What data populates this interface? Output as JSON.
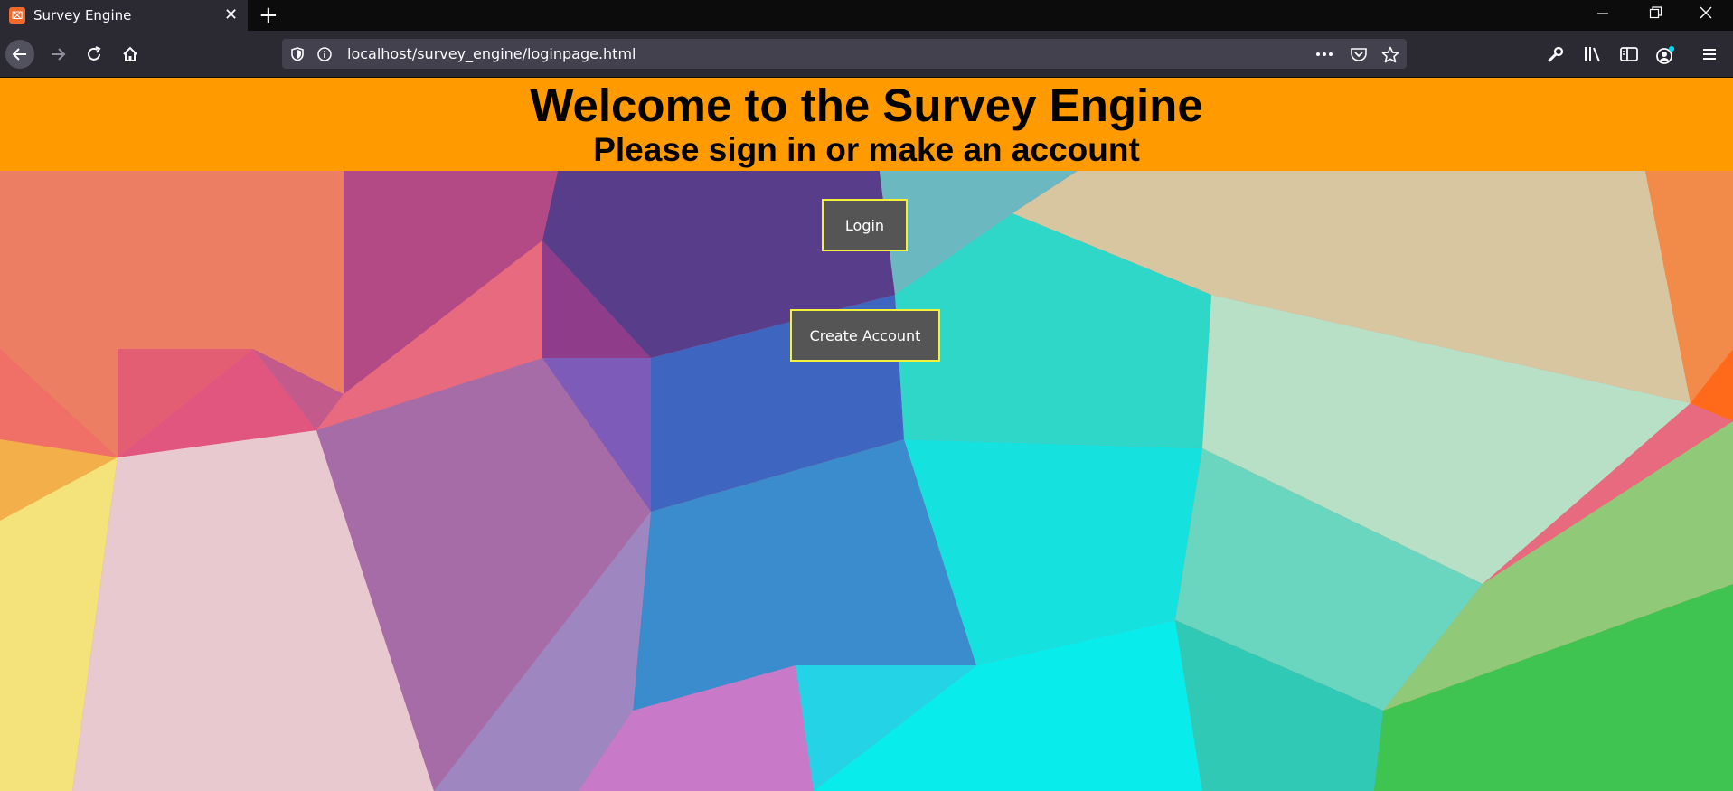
{
  "browser": {
    "tab_title": "Survey Engine",
    "favicon_glyph": "⌧",
    "close_tab": "✕",
    "new_tab": "+",
    "window_controls": {
      "minimize": "—",
      "restore": "❐",
      "close": "✕"
    },
    "url": "localhost/survey_engine/loginpage.html"
  },
  "page": {
    "title": "Welcome to the Survey Engine",
    "subtitle": "Please sign in or make an account",
    "login_label": "Login",
    "create_label": "Create Account"
  },
  "colors": {
    "header_bg": "#ff9b00",
    "button_bg": "#555555",
    "button_border": "#f2f23a"
  },
  "icons": [
    "back-arrow-icon",
    "forward-arrow-icon",
    "reload-icon",
    "home-icon",
    "tracking-shield-icon",
    "info-icon",
    "more-icon",
    "pocket-icon",
    "bookmark-star-icon",
    "wrench-icon",
    "library-icon",
    "sidebar-icon",
    "account-icon",
    "menu-icon"
  ]
}
